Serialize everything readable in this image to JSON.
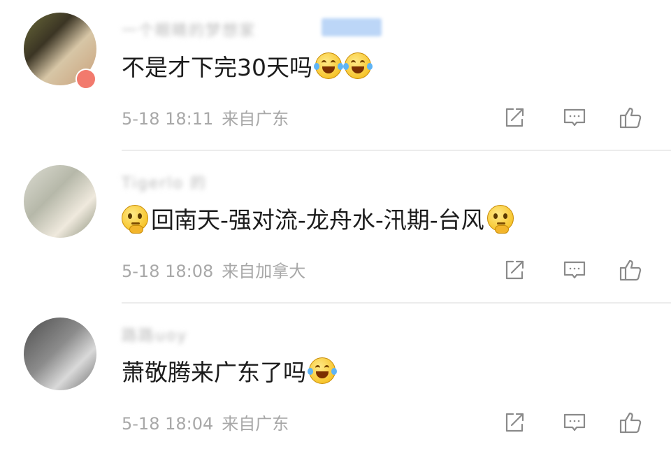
{
  "comments": [
    {
      "username": "一个眼睛的梦想家",
      "tag": "badge",
      "text": "不是才下完30天吗",
      "emojis": [
        "laugh-cry-emoji",
        "laugh-cry-emoji"
      ],
      "time": "5-18 18:11",
      "source": "来自广东"
    },
    {
      "username": "Tigerlo 的",
      "text": "回南天-强对流-龙舟水-汛期-台风",
      "emojis": [
        "thinking-emoji",
        "thinking-emoji"
      ],
      "time": "5-18 18:08",
      "source": "来自加拿大"
    },
    {
      "username": "路路uoy",
      "text": "萧敬腾来广东了吗",
      "emojis": [
        "laugh-cry-emoji"
      ],
      "time": "5-18 18:04",
      "source": "来自广东"
    }
  ],
  "icons": {
    "share": "share-icon",
    "reply": "comment-icon",
    "like": "thumbs-up-icon"
  },
  "colors": {
    "meta_text": "#a8a8a8",
    "icon": "#8a8a8a",
    "divider": "#ececec",
    "blurred_name": "#b9b9b9",
    "blurred_tag": "#bcd6f7"
  }
}
